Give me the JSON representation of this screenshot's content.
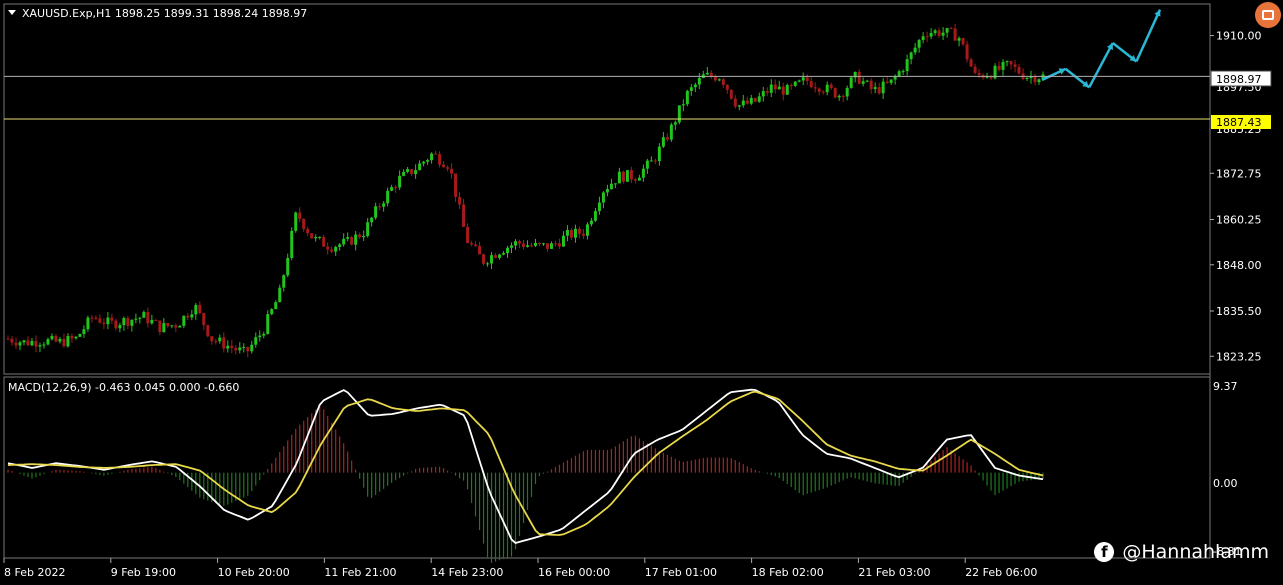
{
  "header": {
    "symbol_info": "XAUUSD.Exp,H1  1898.25 1899.31 1898.24 1898.97",
    "macd_info": "MACD(12,26,9) -0.463 0.045 0.000 -0.660"
  },
  "price_labels": {
    "current": "1898.97",
    "level": "1887.43",
    "partial_top": "1897.50",
    "partial_bottom": "1885.25",
    "macd_max": "9.37",
    "macd_zero": "0.00",
    "macd_min": "-8.81"
  },
  "watermark": {
    "handle": "@Hannahlamm",
    "icon": "facebook-icon"
  },
  "colors": {
    "bull": "#22c41e",
    "bear": "#a51a1a",
    "macd_line": "#ffffff",
    "signal_line": "#e8d84a",
    "hist_pos": "#b02020",
    "hist_neg": "#1d7a1d",
    "projection": "#2bb8d6",
    "current_line": "#b0b0b0",
    "level_line": "#e8e070",
    "label_bg": "#ffff00"
  },
  "chart_data": [
    {
      "type": "candlestick",
      "title": "XAUUSD.Exp,H1",
      "y_ticks": [
        "1910.00",
        "1872.75",
        "1860.25",
        "1848.00",
        "1835.50",
        "1823.25"
      ],
      "x_ticks": [
        "8 Feb 2022",
        "9 Feb 19:00",
        "10 Feb 20:00",
        "11 Feb 21:00",
        "14 Feb 23:00",
        "16 Feb 00:00",
        "17 Feb 01:00",
        "18 Feb 02:00",
        "21 Feb 03:00",
        "22 Feb 06:00"
      ],
      "ylim": [
        1819,
        1918
      ],
      "close_path": [
        1828,
        1827,
        1827.5,
        1827,
        1828,
        1834,
        1832,
        1833,
        1834,
        1831,
        1832,
        1837,
        1828,
        1826,
        1824,
        1830,
        1840,
        1862,
        1855,
        1853,
        1854,
        1857,
        1865,
        1871,
        1874,
        1878,
        1875,
        1855,
        1849,
        1852,
        1854,
        1853,
        1853,
        1856,
        1857,
        1868,
        1872,
        1872,
        1876,
        1884,
        1894,
        1899,
        1899,
        1891,
        1892,
        1896,
        1895,
        1898,
        1896,
        1894,
        1899,
        1895,
        1897,
        1903,
        1911,
        1911,
        1910,
        1899,
        1900,
        1902,
        1899,
        1898.97
      ],
      "horizontal_lines": [
        1898.97,
        1887.43
      ],
      "projection_zigzag": [
        1898,
        1901,
        1896,
        1908,
        1903,
        1917
      ]
    },
    {
      "type": "macd",
      "title": "MACD(12,26,9)",
      "values": {
        "macd": -0.463,
        "signal": 0.045,
        "hist": 0.0,
        "last": -0.66
      },
      "ylim": [
        -8.81,
        9.37
      ],
      "macd_path": [
        1.0,
        0.5,
        1.0,
        0.7,
        0.3,
        0.8,
        1.2,
        0.6,
        -1.5,
        -4.0,
        -5.0,
        -3.5,
        1.0,
        7.5,
        8.8,
        6.0,
        6.2,
        6.8,
        7.2,
        6.0,
        -2.0,
        -7.5,
        -6.8,
        -6.0,
        -4.0,
        -2.0,
        2.0,
        3.5,
        4.5,
        6.5,
        8.5,
        8.8,
        7.5,
        4.0,
        2.0,
        1.5,
        0.5,
        -0.5,
        0.5,
        3.5,
        4.0,
        0.5,
        -0.3,
        -0.7
      ],
      "signal_path": [
        0.8,
        0.9,
        0.8,
        0.6,
        0.5,
        0.6,
        0.8,
        0.9,
        0.2,
        -1.8,
        -3.5,
        -4.2,
        -2.0,
        3.0,
        7.0,
        7.8,
        6.8,
        6.5,
        6.8,
        6.6,
        4.0,
        -2.0,
        -6.5,
        -6.6,
        -5.5,
        -3.5,
        -0.5,
        2.0,
        3.8,
        5.5,
        7.5,
        8.6,
        7.8,
        5.5,
        3.0,
        1.8,
        1.2,
        0.4,
        0.2,
        1.8,
        3.5,
        2.0,
        0.3,
        -0.3
      ]
    }
  ]
}
